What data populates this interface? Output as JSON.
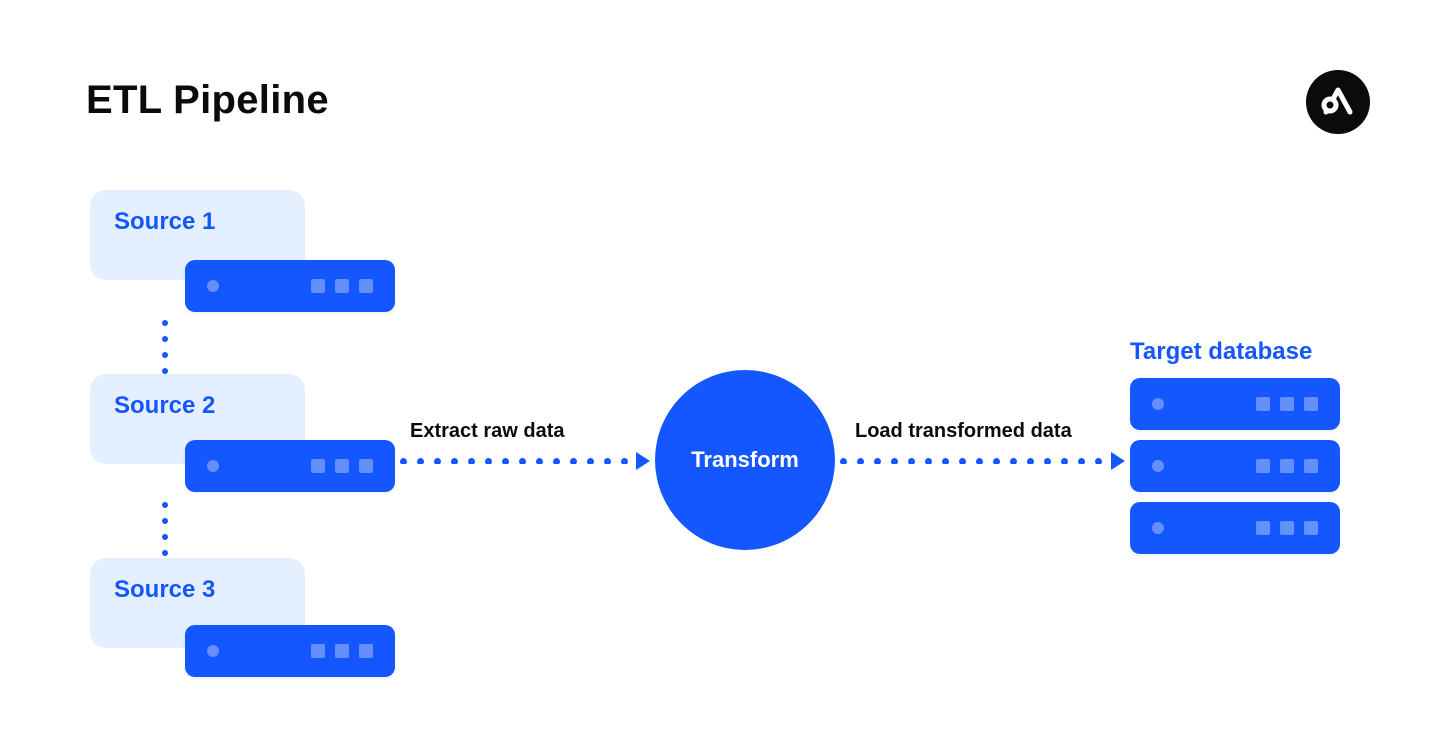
{
  "title": "ETL Pipeline",
  "sources": [
    {
      "label": "Source 1"
    },
    {
      "label": "Source 2"
    },
    {
      "label": "Source 3"
    }
  ],
  "arrows": {
    "extract_label": "Extract raw data",
    "load_label": "Load transformed data"
  },
  "transform_label": "Transform",
  "target_label": "Target database",
  "colors": {
    "blue": "#1557ff",
    "lightblue": "#e4efff",
    "black": "#0b0b0b"
  }
}
